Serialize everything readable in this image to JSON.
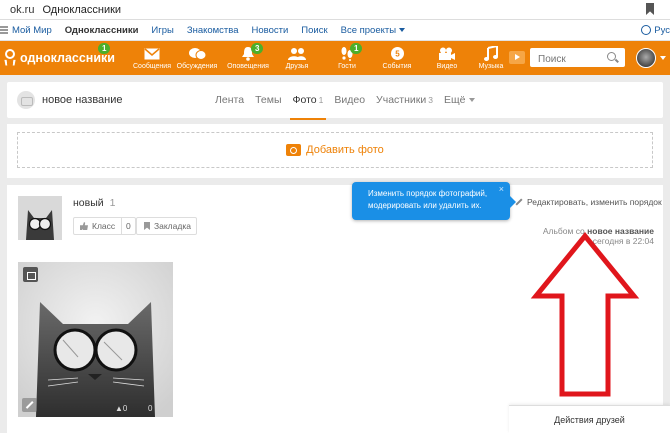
{
  "browser": {
    "domain": "ok.ru",
    "title": "Одноклассники"
  },
  "portal": {
    "items": [
      "Мой Мир",
      "Одноклассники",
      "Игры",
      "Знакомства",
      "Новости",
      "Поиск",
      "Все проекты"
    ],
    "lang": "Рус"
  },
  "topbar": {
    "logo_text": "одноклассники",
    "logo_badge": "1",
    "nav": [
      {
        "label": "Сообщения",
        "badge": "",
        "icon": "envelope-icon"
      },
      {
        "label": "Обсуждения",
        "badge": "",
        "icon": "chat-bubbles-icon"
      },
      {
        "label": "Оповещения",
        "badge": "3",
        "icon": "bell-icon"
      },
      {
        "label": "Друзья",
        "badge": "",
        "icon": "friends-icon"
      },
      {
        "label": "Гости",
        "badge": "1",
        "icon": "footprints-icon"
      },
      {
        "label": "События",
        "badge": "",
        "icon": "events-icon"
      },
      {
        "label": "Видео",
        "badge": "",
        "icon": "video-camera-icon"
      },
      {
        "label": "Музыка",
        "badge": "",
        "icon": "music-note-icon"
      }
    ],
    "search_placeholder": "Поиск"
  },
  "group": {
    "name": "новое название",
    "tabs": [
      {
        "label": "Лента",
        "count": ""
      },
      {
        "label": "Темы",
        "count": ""
      },
      {
        "label": "Фото",
        "count": "1"
      },
      {
        "label": "Видео",
        "count": ""
      },
      {
        "label": "Участники",
        "count": "3"
      },
      {
        "label": "Ещё",
        "count": ""
      }
    ]
  },
  "add_photo": {
    "label": "Добавить фото"
  },
  "album": {
    "name": "новый",
    "count": "1",
    "like_label": "Класс",
    "like_count": "0",
    "bookmark_label": "Закладка",
    "edit_link": "Редактировать, изменить порядок",
    "meta_prefix": "Альбом со",
    "meta_group": "новое название",
    "meta_time": "сегодня в 22:04",
    "photo_likes": "0",
    "photo_comments": "0"
  },
  "tooltip": {
    "line1": "Изменить порядок фотографий,",
    "line2": "модерировать или удалить их.",
    "close": "×"
  },
  "friends_panel": {
    "label": "Действия друзей"
  },
  "colors": {
    "brand_orange": "#ee8208",
    "badge_green": "#4caf2a",
    "tooltip_blue": "#1a8fe6",
    "annotation_red": "#e0161c"
  }
}
